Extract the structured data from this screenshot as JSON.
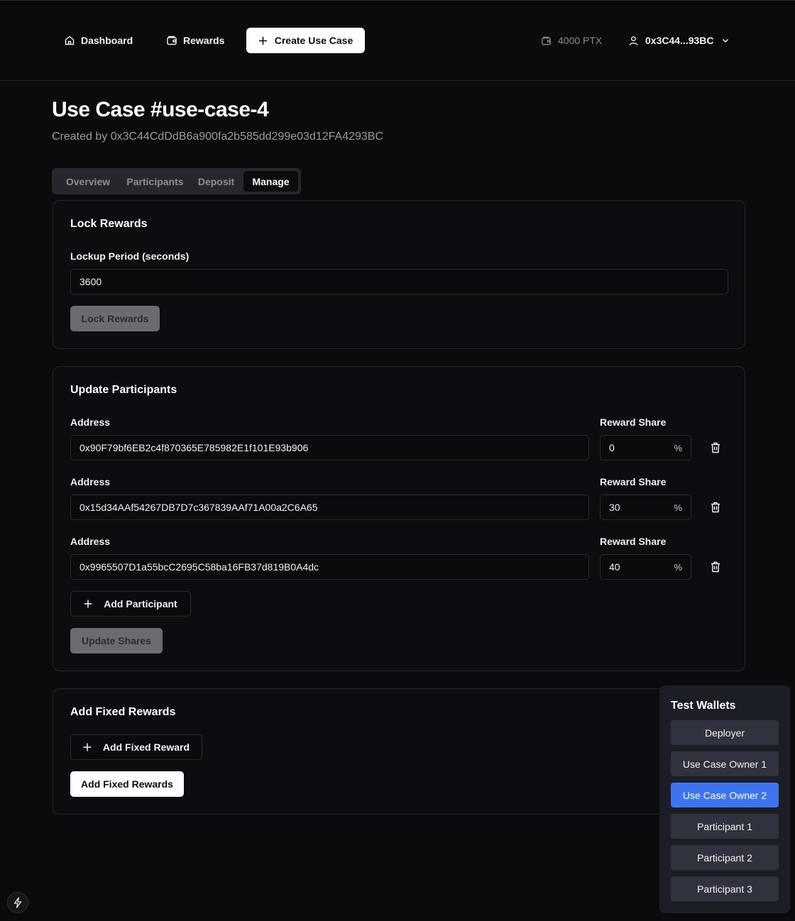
{
  "nav": {
    "dashboard": "Dashboard",
    "rewards": "Rewards",
    "create": "Create Use Case",
    "balance": "4000 PTX",
    "account": "0x3C44...93BC"
  },
  "page": {
    "title": "Use Case #use-case-4",
    "created_by": "Created by 0x3C44CdDdB6a900fa2b585dd299e03d12FA4293BC"
  },
  "tabs": [
    {
      "label": "Overview",
      "active": false
    },
    {
      "label": "Participants",
      "active": false
    },
    {
      "label": "Deposit",
      "active": false
    },
    {
      "label": "Manage",
      "active": true
    }
  ],
  "lock": {
    "title": "Lock Rewards",
    "period_label": "Lockup Period (seconds)",
    "period_value": "3600",
    "button": "Lock Rewards"
  },
  "update": {
    "title": "Update Participants",
    "address_label": "Address",
    "share_label": "Reward Share",
    "percent_symbol": "%",
    "participants": [
      {
        "address": "0x90F79bf6EB2c4f870365E785982E1f101E93b906",
        "share": "0"
      },
      {
        "address": "0x15d34AAf54267DB7D7c367839AAf71A00a2C6A65",
        "share": "30"
      },
      {
        "address": "0x9965507D1a55bcC2695C58ba16FB37d819B0A4dc",
        "share": "40"
      }
    ],
    "add_button": "Add Participant",
    "submit_button": "Update Shares"
  },
  "fixed": {
    "title": "Add Fixed Rewards",
    "add_button": "Add Fixed Reward",
    "submit_button": "Add Fixed Rewards"
  },
  "wallets": {
    "title": "Test Wallets",
    "items": [
      {
        "label": "Deployer",
        "active": false
      },
      {
        "label": "Use Case Owner 1",
        "active": false
      },
      {
        "label": "Use Case Owner 2",
        "active": true
      },
      {
        "label": "Participant 1",
        "active": false
      },
      {
        "label": "Participant 2",
        "active": false
      },
      {
        "label": "Participant 3",
        "active": false
      }
    ]
  },
  "colors": {
    "background": "#0a0b0d",
    "accent": "#3d74f0",
    "panel": "#1c1e26"
  }
}
